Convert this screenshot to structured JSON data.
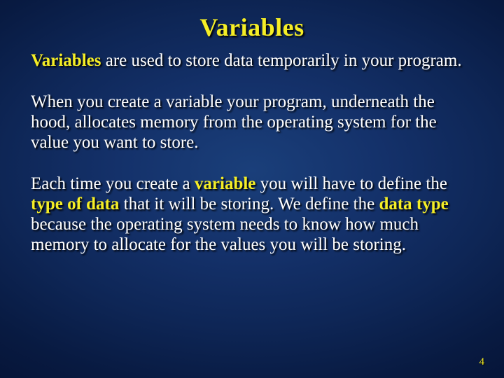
{
  "title": "Variables",
  "p1_a": "Variables",
  "p1_b": " are used to store data temporarily in your program.",
  "p2": "When you create a variable your program, underneath the hood, allocates memory from the operating system for the value you want to store.",
  "p3_a": "Each time you create a ",
  "p3_b": "variable",
  "p3_c": " you will have to define the ",
  "p3_d": "type of data",
  "p3_e": " that it will be storing. We define the ",
  "p3_f": "data type",
  "p3_g": " because the operating system needs to know how much memory to allocate for the values you will be storing.",
  "page_number": "4"
}
